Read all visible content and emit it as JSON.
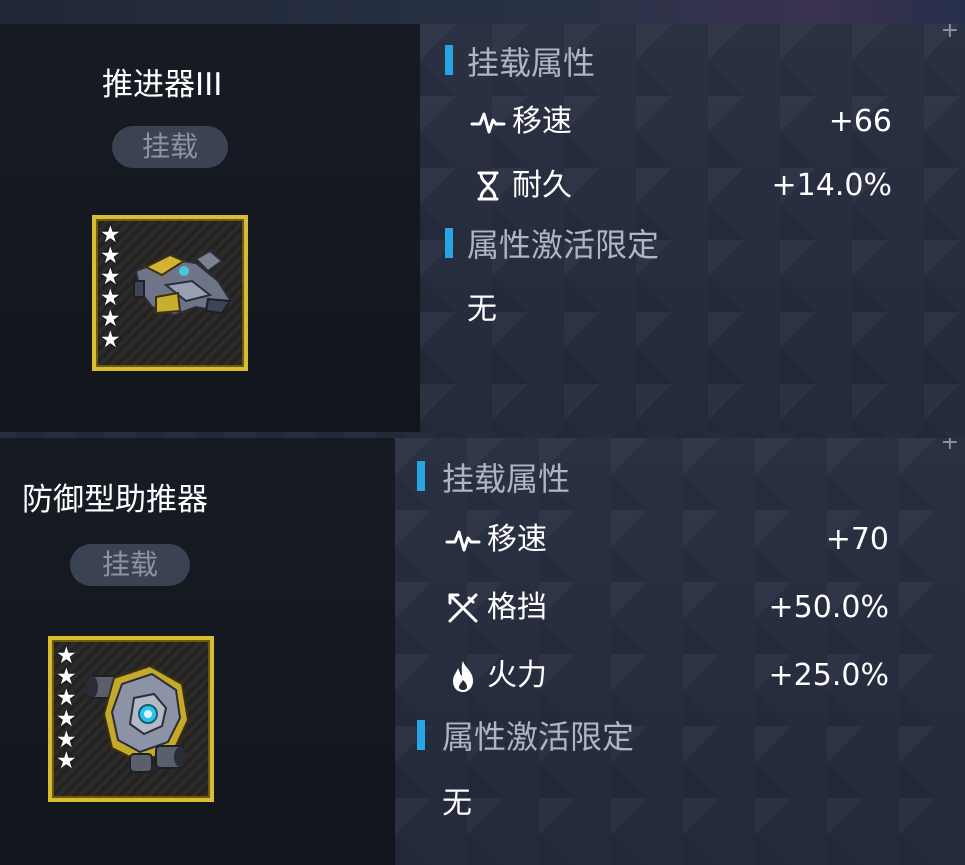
{
  "cards": [
    {
      "name": "推进器III",
      "badge": "挂载",
      "stars": [
        "★",
        "★",
        "★",
        "★",
        "★",
        "★"
      ],
      "section_attributes": "挂载属性",
      "stats": [
        {
          "icon": "pulse-icon",
          "label": "移速",
          "value": "+66"
        },
        {
          "icon": "hourglass-icon",
          "label": "耐久",
          "value": "+14.0%"
        }
      ],
      "section_limit": "属性激活限定",
      "limit_value": "无"
    },
    {
      "name": "防御型助推器",
      "badge": "挂载",
      "stars": [
        "★",
        "★",
        "★",
        "★",
        "★",
        "★"
      ],
      "section_attributes": "挂载属性",
      "stats": [
        {
          "icon": "pulse-icon",
          "label": "移速",
          "value": "+70"
        },
        {
          "icon": "block-icon",
          "label": "格挡",
          "value": "+50.0%"
        },
        {
          "icon": "fire-icon",
          "label": "火力",
          "value": "+25.0%"
        }
      ],
      "section_limit": "属性激活限定",
      "limit_value": "无"
    }
  ],
  "colors": {
    "accent_bar": "#27a6e6",
    "frame_gold": "#d8bd33",
    "badge_bg": "#3b4352",
    "badge_text": "#8c94a2",
    "section_text": "#aeb5c3"
  }
}
